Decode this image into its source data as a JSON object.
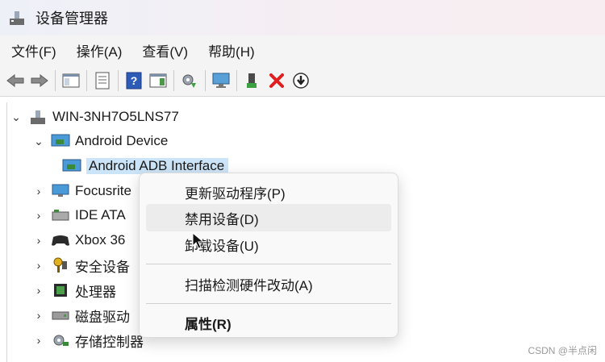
{
  "window": {
    "title": "设备管理器",
    "app_icon": "device-manager-icon"
  },
  "menubar": {
    "items": [
      {
        "label": "文件(F)"
      },
      {
        "label": "操作(A)"
      },
      {
        "label": "查看(V)"
      },
      {
        "label": "帮助(H)"
      }
    ]
  },
  "toolbar": {
    "icons": [
      "back-arrow-icon",
      "forward-arrow-icon",
      "show-hide-console-tree-icon",
      "properties-icon",
      "help-icon",
      "action-pane-icon",
      "update-driver-icon",
      "scan-hardware-icon",
      "computer-monitor-icon",
      "enable-device-icon",
      "uninstall-x-icon",
      "disable-device-icon"
    ]
  },
  "tree": {
    "root": {
      "label": "WIN-3NH7O5LNS77",
      "expanded": true
    },
    "items": [
      {
        "label": "Android Device",
        "expanded": true,
        "level": 1
      },
      {
        "label": "Android ADB Interface",
        "selected": true,
        "level": 2
      },
      {
        "label": "Focusrite",
        "level": 1
      },
      {
        "label": "IDE ATA",
        "level": 1
      },
      {
        "label": "Xbox 36",
        "level": 1
      },
      {
        "label": "安全设备",
        "level": 1
      },
      {
        "label": "处理器",
        "level": 1
      },
      {
        "label": "磁盘驱动",
        "level": 1
      },
      {
        "label": "存储控制器",
        "level": 1
      }
    ]
  },
  "context_menu": {
    "items": [
      {
        "label": "更新驱动程序(P)"
      },
      {
        "label": "禁用设备(D)",
        "hover": true
      },
      {
        "label": "卸载设备(U)"
      },
      {
        "label": "扫描检测硬件改动(A)"
      },
      {
        "label": "属性(R)",
        "bold": true
      }
    ]
  },
  "watermark": "CSDN @半点闲",
  "colors": {
    "selection": "#cce4f7",
    "titlebar_start": "#eef0f8",
    "titlebar_end": "#f8eef1"
  }
}
